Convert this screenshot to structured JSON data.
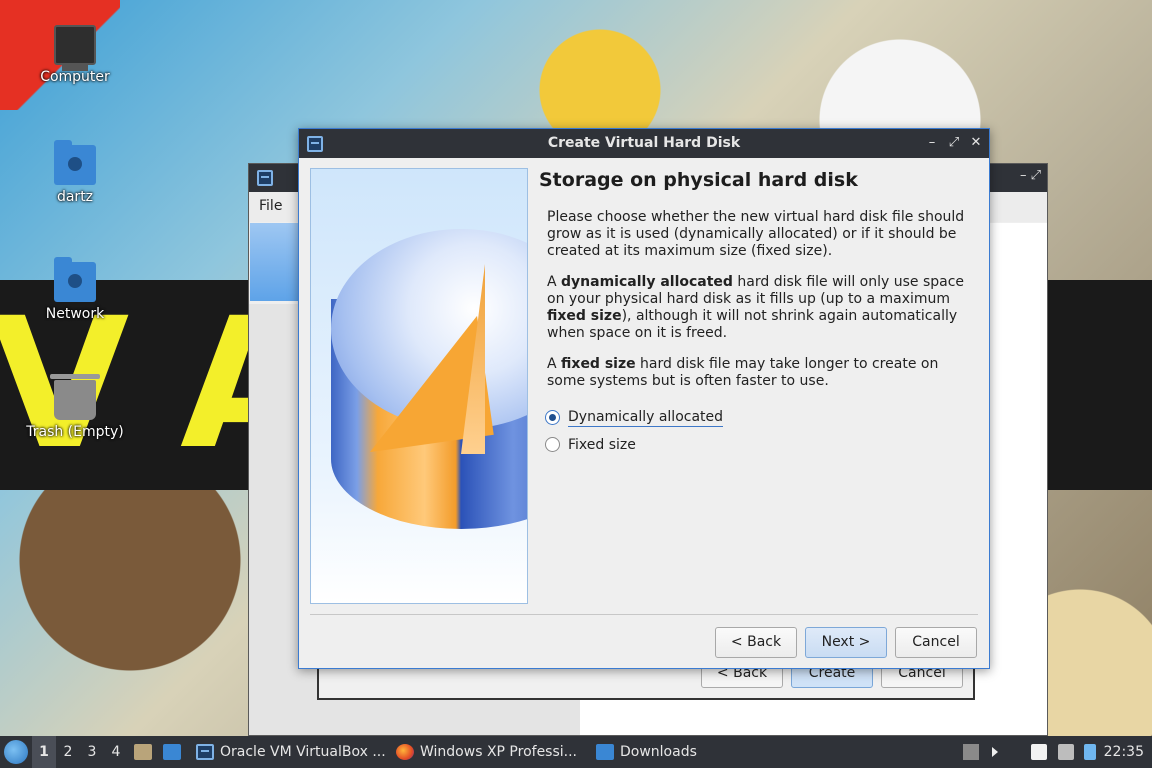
{
  "desktop": {
    "icons": [
      {
        "label": "Computer",
        "icon": "computer-icon"
      },
      {
        "label": "dartz",
        "icon": "home-folder-icon"
      },
      {
        "label": "Network",
        "icon": "network-folder-icon"
      },
      {
        "label": "Trash (Empty)",
        "icon": "trash-icon"
      }
    ],
    "banner_text": "V AS                            EM"
  },
  "background_window": {
    "menu_file": "File",
    "buttons": {
      "back": "< Back",
      "create": "Create",
      "cancel": "Cancel"
    }
  },
  "dialog": {
    "title": "Create Virtual Hard Disk",
    "heading": "Storage on physical hard disk",
    "para1": "Please choose whether the new virtual hard disk file should grow as it is used (dynamically allocated) or if it should be created at its maximum size (fixed size).",
    "para2": {
      "t1": "A ",
      "b1": "dynamically allocated",
      "t2": " hard disk file will only use space on your physical hard disk as it fills up (up to a maximum ",
      "b2": "fixed size",
      "t3": "), although it will not shrink again automatically when space on it is freed."
    },
    "para3": {
      "t1": "A ",
      "b1": "fixed size",
      "t2": " hard disk file may take longer to create on some systems but is often faster to use."
    },
    "options": [
      {
        "label": "Dynamically allocated",
        "selected": true
      },
      {
        "label": "Fixed size",
        "selected": false
      }
    ],
    "buttons": {
      "back": "< Back",
      "next": "Next >",
      "cancel": "Cancel"
    },
    "window_controls": {
      "minimize": "–",
      "maximize": "⤢",
      "close": "✕"
    }
  },
  "taskbar": {
    "workspaces": [
      "1",
      "2",
      "3",
      "4"
    ],
    "active_workspace": "1",
    "tasks": [
      {
        "label": "Oracle VM VirtualBox ...",
        "icon": "virtualbox-icon"
      },
      {
        "label": "Windows XP Professi...",
        "icon": "firefox-icon"
      },
      {
        "label": "Downloads",
        "icon": "folder-icon"
      }
    ],
    "clock": "22:35"
  }
}
